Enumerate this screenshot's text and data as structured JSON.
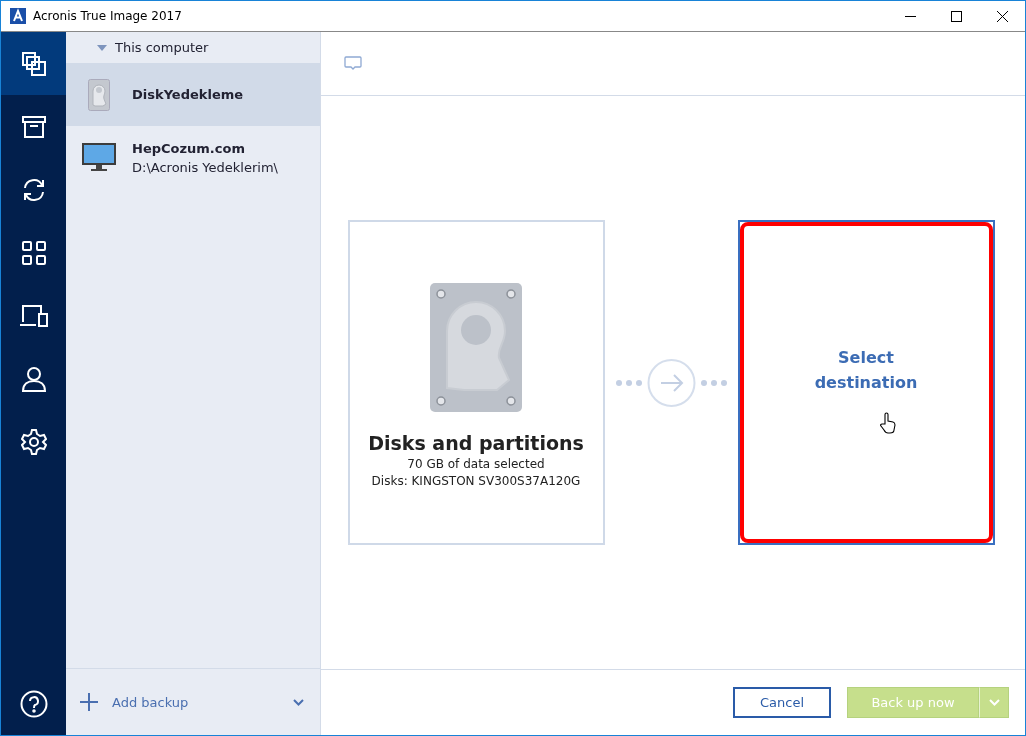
{
  "window": {
    "title": "Acronis True Image 2017"
  },
  "nav": [
    {
      "kind": "backup",
      "selected": true
    },
    {
      "kind": "archive",
      "selected": false
    },
    {
      "kind": "sync",
      "selected": false
    },
    {
      "kind": "dashboard",
      "selected": false
    },
    {
      "kind": "devices",
      "selected": false
    },
    {
      "kind": "account",
      "selected": false
    },
    {
      "kind": "settings",
      "selected": false
    },
    {
      "kind": "help",
      "selected": false
    }
  ],
  "backup_list": {
    "group": "This computer",
    "expanded": true,
    "items": [
      {
        "kind": "disk",
        "name": "DiskYedekleme",
        "selected": true
      },
      {
        "kind": "monitor",
        "name": "HepCozum.com",
        "path": "D:\\Acronis Yedeklerim\\",
        "selected": false
      }
    ]
  },
  "add_backup": "Add backup",
  "source": {
    "title": "Disks and partitions",
    "lines": [
      "70 GB of data selected",
      "Disks: KINGSTON SV300S37A120G"
    ]
  },
  "destination": {
    "label": "Select destination",
    "highlighted": true
  },
  "buttons": {
    "cancel": "Cancel",
    "backup": {
      "label": "Back up now",
      "disabled": true
    }
  }
}
